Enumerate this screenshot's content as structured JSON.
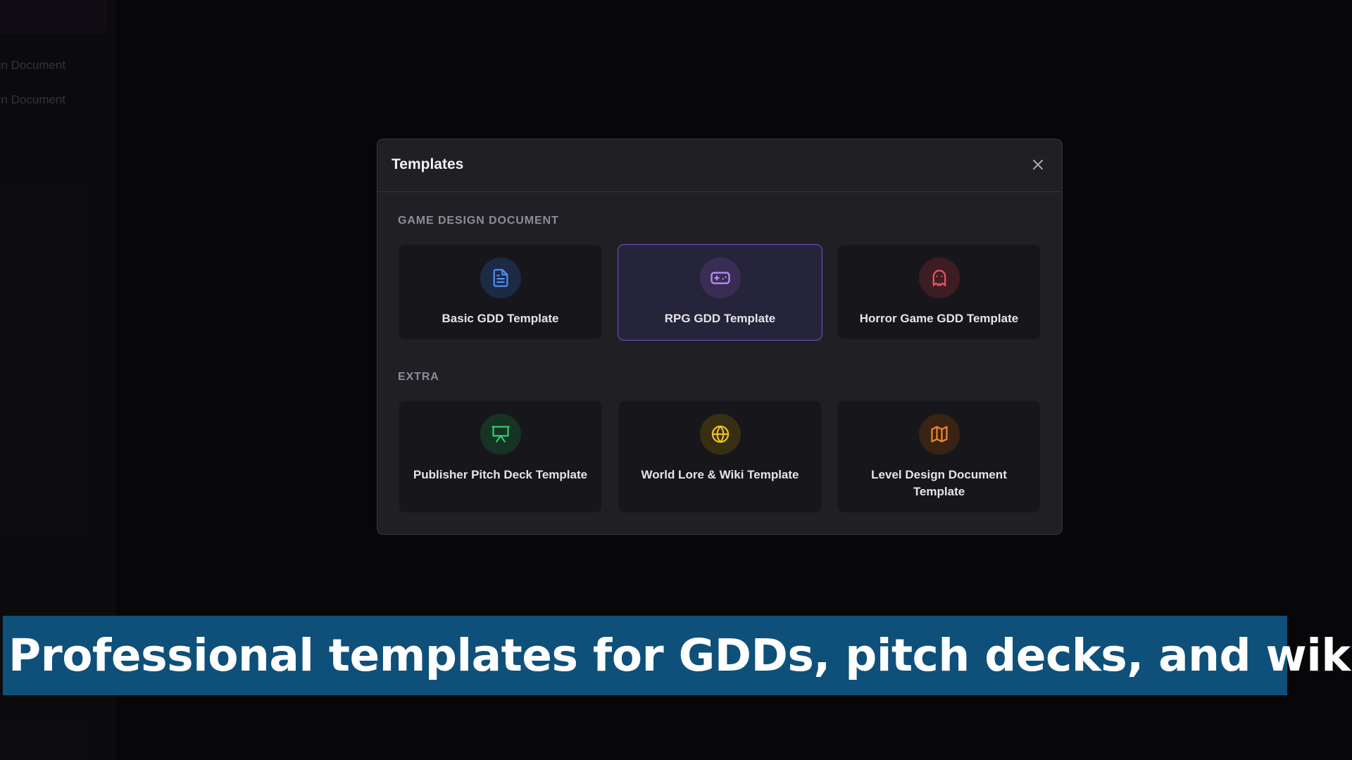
{
  "background": {
    "sidebar_items": [
      "gn Document",
      "gn Document"
    ]
  },
  "modal": {
    "title": "Templates",
    "close_icon": "close-icon",
    "sections": [
      {
        "label": "GAME DESIGN DOCUMENT",
        "cards": [
          {
            "label": "Basic GDD Template",
            "icon": "document-icon",
            "color": "#4f8ff7",
            "selected": false
          },
          {
            "label": "RPG GDD Template",
            "icon": "gamepad-icon",
            "color": "#a67be8",
            "selected": true
          },
          {
            "label": "Horror Game GDD Template",
            "icon": "ghost-icon",
            "color": "#ec5466",
            "selected": false
          }
        ]
      },
      {
        "label": "EXTRA",
        "cards": [
          {
            "label": "Publisher Pitch Deck Template",
            "icon": "presentation-icon",
            "color": "#2fce70",
            "selected": false
          },
          {
            "label": "World Lore & Wiki Template",
            "icon": "globe-icon",
            "color": "#eac21f",
            "selected": false
          },
          {
            "label": "Level Design Document Template",
            "icon": "map-icon",
            "color": "#f0892d",
            "selected": false
          }
        ]
      }
    ]
  },
  "caption": {
    "text": "Professional templates for GDDs, pitch decks, and wikis."
  },
  "colors": {
    "accent": "#7a54c9",
    "caption_bg": "#0e5079"
  }
}
